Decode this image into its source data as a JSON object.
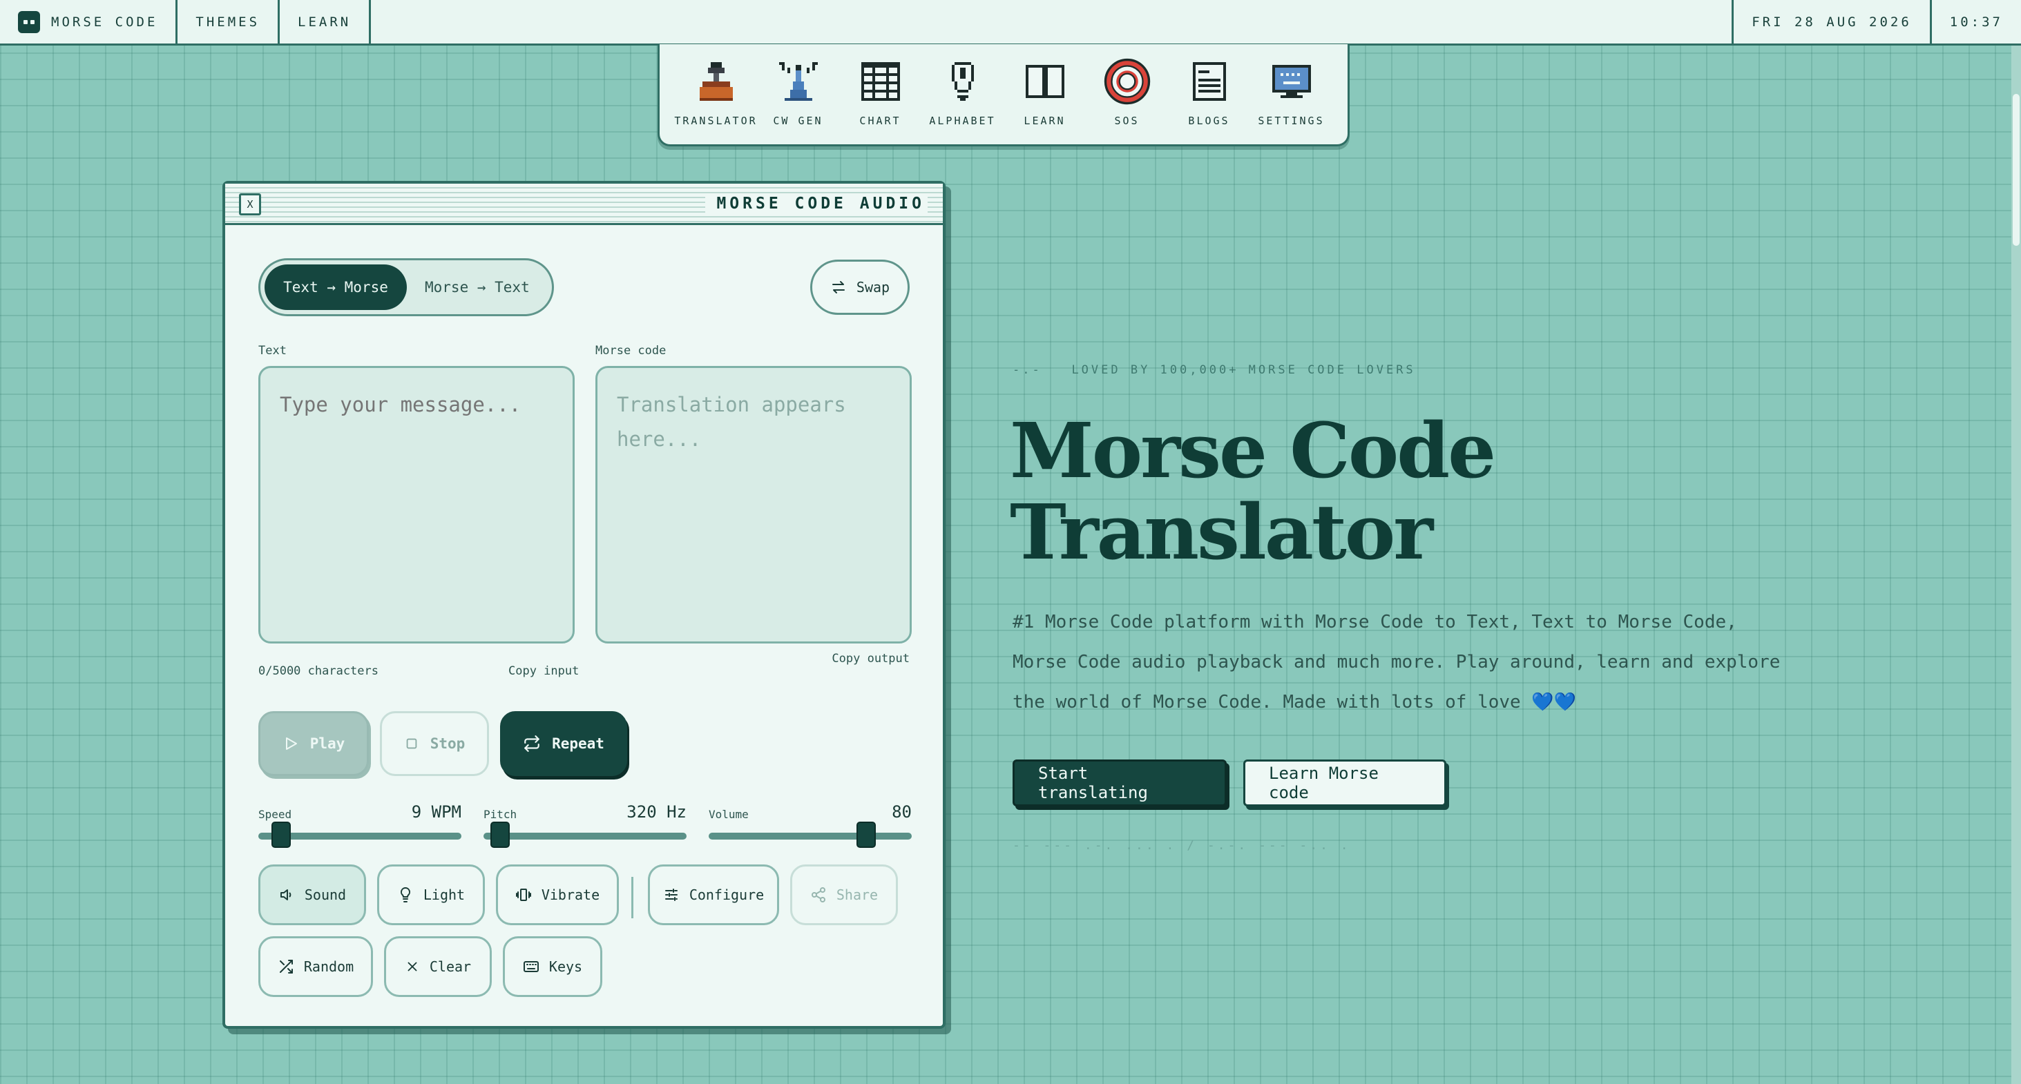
{
  "topbar": {
    "brand": "MORSE CODE",
    "nav": [
      "THEMES",
      "LEARN"
    ],
    "date": "FRI 28 AUG 2026",
    "time": "10:37"
  },
  "dock": [
    {
      "label": "TRANSLATOR",
      "icon": "telegraph-key-icon"
    },
    {
      "label": "CW GEN",
      "icon": "radio-tower-icon"
    },
    {
      "label": "CHART",
      "icon": "grid-chart-icon"
    },
    {
      "label": "ALPHABET",
      "icon": "lightbulb-icon"
    },
    {
      "label": "LEARN",
      "icon": "open-book-icon"
    },
    {
      "label": "SOS",
      "icon": "life-ring-icon"
    },
    {
      "label": "BLOGS",
      "icon": "document-icon"
    },
    {
      "label": "SETTINGS",
      "icon": "monitor-icon"
    }
  ],
  "window": {
    "close": "X",
    "title": "MORSE CODE AUDIO",
    "modes": [
      "Text → Morse",
      "Morse → Text"
    ],
    "active_mode": 0,
    "swap": "Swap",
    "input": {
      "label": "Text",
      "placeholder": "Type your message...",
      "value": "",
      "char_count": "0/5000 characters",
      "copy": "Copy input"
    },
    "output": {
      "label": "Morse code",
      "placeholder": "Translation appears here...",
      "copy": "Copy output"
    },
    "actions": {
      "play": "Play",
      "stop": "Stop",
      "repeat": "Repeat"
    },
    "sliders": {
      "speed": {
        "label": "Speed",
        "value": "9 WPM",
        "fraction": 0.1
      },
      "pitch": {
        "label": "Pitch",
        "value": "320 Hz",
        "fraction": 0.08
      },
      "volume": {
        "label": "Volume",
        "value": "80",
        "fraction": 0.8
      }
    },
    "chips": {
      "sound": "Sound",
      "light": "Light",
      "vibrate": "Vibrate",
      "configure": "Configure",
      "share": "Share",
      "random": "Random",
      "clear": "Clear",
      "keys": "Keys"
    }
  },
  "hero": {
    "tagline_prefix": "-.-",
    "tagline": "LOVED BY 100,000+ MORSE CODE LOVERS",
    "title": "Morse Code Translator",
    "description": "#1 Morse Code platform with Morse Code to Text, Text to Morse Code, Morse Code audio playback and much more. Play around, learn and explore the world of Morse Code. Made with lots of love 💙💙",
    "primary_cta": "Start translating",
    "secondary_cta": "Learn Morse code",
    "morse_decoration": "-- --- .-. ... . / -.-. --- -.. ."
  },
  "colors": {
    "background": "#89c8bb",
    "panel": "#eef8f5",
    "accent_dark": "#15463f",
    "border": "#2f6e64"
  }
}
